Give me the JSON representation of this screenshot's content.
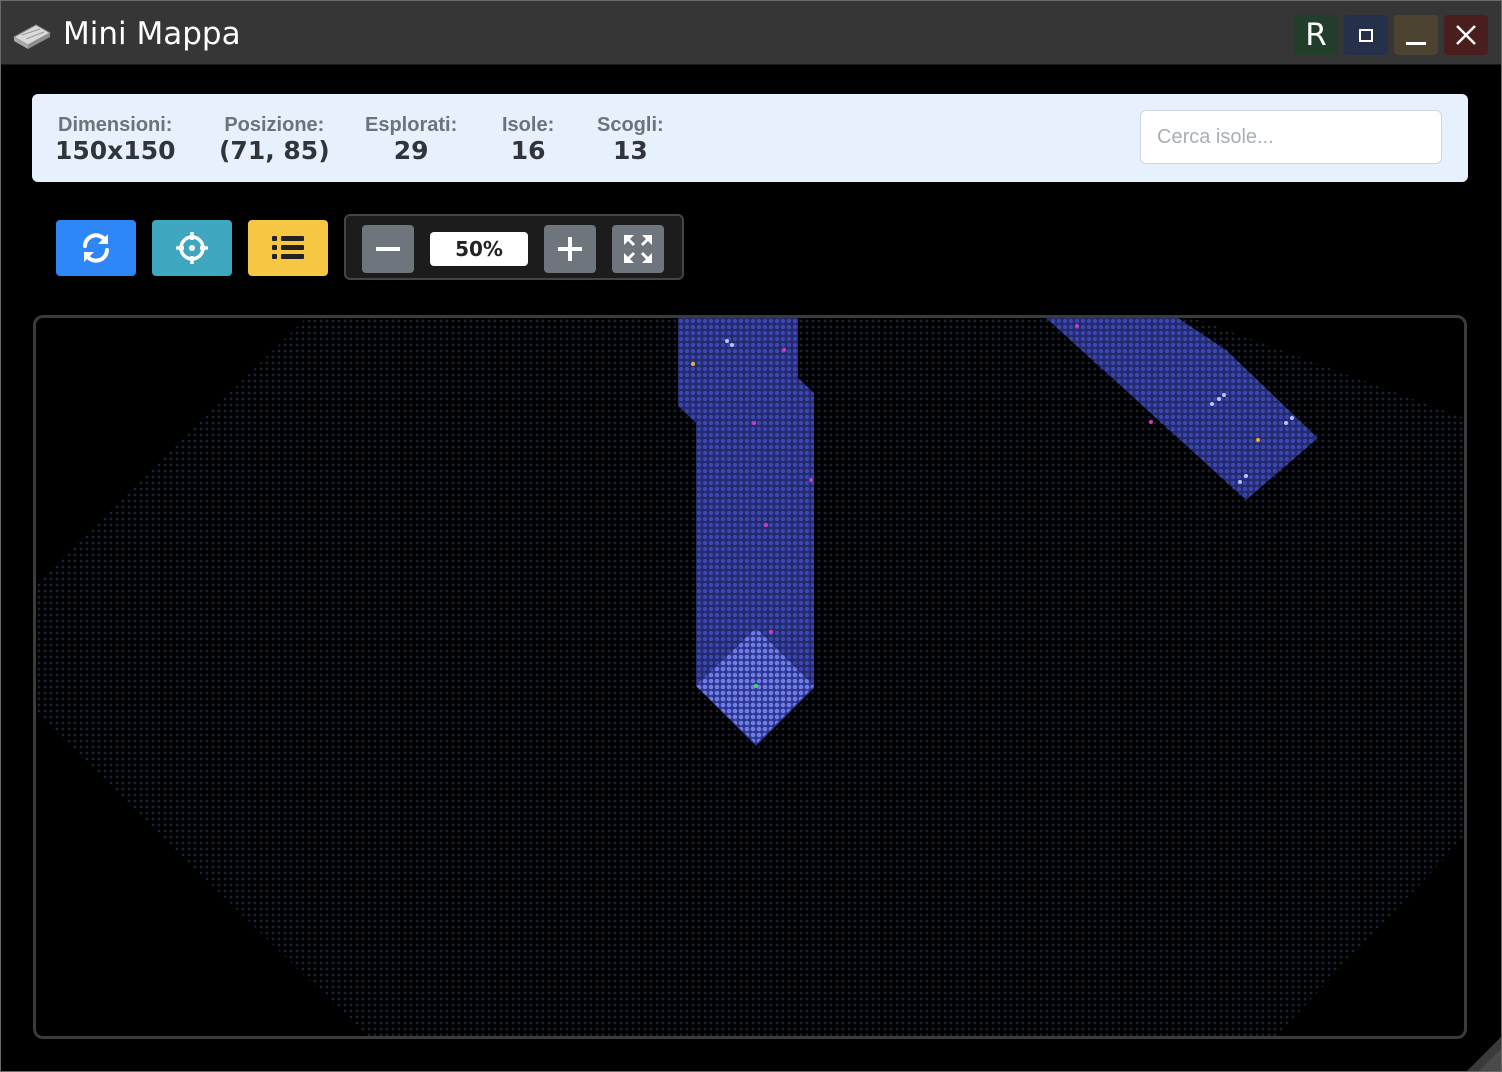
{
  "window": {
    "title": "Mini Mappa",
    "buttons": {
      "r_label": "R"
    }
  },
  "stats": {
    "dimensions": {
      "label": "Dimensioni:",
      "value": "150x150"
    },
    "position": {
      "label": "Posizione:",
      "value": "(71, 85)"
    },
    "explored": {
      "label": "Esplorati:",
      "value": "29"
    },
    "islands": {
      "label": "Isole:",
      "value": "16"
    },
    "reefs": {
      "label": "Scogli:",
      "value": "13"
    }
  },
  "search": {
    "placeholder": "Cerca isole...",
    "value": ""
  },
  "toolbar": {
    "refresh_icon": "refresh-icon",
    "locate_icon": "crosshair-icon",
    "list_icon": "list-icon"
  },
  "zoom": {
    "level": "50%",
    "out_icon": "minus-icon",
    "in_icon": "plus-icon",
    "fit_icon": "expand-icon"
  },
  "map": {
    "colors": {
      "unexplored_tile": "#1a2236",
      "explored_tile": "#3b47b4",
      "current_area": "#6e7ee6",
      "island": "#e8b23a",
      "reef": "#b7c4ff",
      "marker": "#d03cc0"
    }
  }
}
